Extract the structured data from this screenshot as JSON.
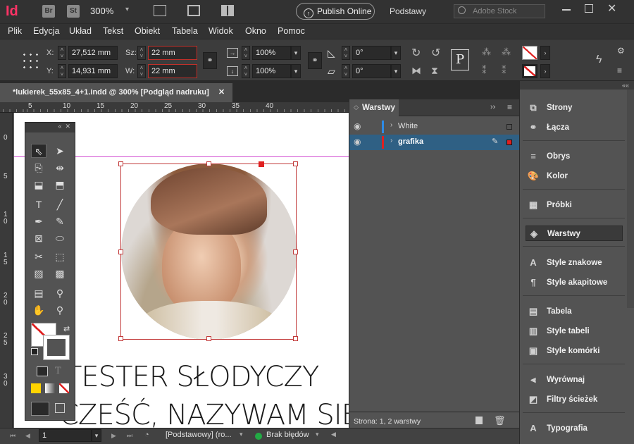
{
  "app": {
    "logo": "Id",
    "br": "Br",
    "st": "St",
    "zoom": "300%",
    "publish_label": "Publish Online",
    "workspace": "Podstawy",
    "search_placeholder": "Adobe Stock"
  },
  "menu": [
    "Plik",
    "Edycja",
    "Układ",
    "Tekst",
    "Obiekt",
    "Tabela",
    "Widok",
    "Okno",
    "Pomoc"
  ],
  "control": {
    "x_label": "X:",
    "x_value": "27,512 mm",
    "y_label": "Y:",
    "y_value": "14,931 mm",
    "w_label": "Sz:",
    "w_value": "22 mm",
    "h_label": "W:",
    "h_value": "22 mm",
    "scale_x": "100%",
    "scale_y": "100%",
    "angle": "0°",
    "shear": "0°"
  },
  "document": {
    "tab_title": "*lukierek_55x85_4+1.indd @ 300% [Podgląd nadruku]",
    "ruler_ticks": [
      "5",
      "10",
      "15",
      "20",
      "25",
      "30",
      "35",
      "40"
    ],
    "vruler_ticks": [
      "0",
      "5",
      "1\n0",
      "1\n5",
      "2\n0",
      "2\n5",
      "3\n0"
    ],
    "line1": "TESTER SŁODYCZY",
    "line2": "CZEŚĆ, NAZYWAM SIE"
  },
  "layers": {
    "title": "Warstwy",
    "rows": [
      {
        "name": "White",
        "color": "#2d8be6"
      },
      {
        "name": "grafika",
        "color": "#e02020"
      }
    ],
    "footer": "Strona: 1, 2 warstwy"
  },
  "dock": [
    {
      "label": "Strony",
      "icon": "pages-icon"
    },
    {
      "label": "Łącza",
      "icon": "links-icon"
    },
    {
      "label": "Obrys",
      "icon": "stroke-icon"
    },
    {
      "label": "Kolor",
      "icon": "color-icon"
    },
    {
      "label": "Próbki",
      "icon": "swatches-icon"
    },
    {
      "label": "Warstwy",
      "icon": "layers-icon"
    },
    {
      "label": "Style znakowe",
      "icon": "char-styles-icon"
    },
    {
      "label": "Style akapitowe",
      "icon": "para-styles-icon"
    },
    {
      "label": "Tabela",
      "icon": "table-icon"
    },
    {
      "label": "Style tabeli",
      "icon": "table-styles-icon"
    },
    {
      "label": "Style komórki",
      "icon": "cell-styles-icon"
    },
    {
      "label": "Wyrównaj",
      "icon": "align-icon"
    },
    {
      "label": "Filtry ścieżek",
      "icon": "pathfinder-icon"
    },
    {
      "label": "Typografia",
      "icon": "glyphs-icon"
    }
  ],
  "status": {
    "page": "1",
    "style": "[Podstawowy] (ro...",
    "preflight": "Brak błędów"
  },
  "colors": {
    "accent": "#ff3366",
    "selection": "#c23a3a",
    "ok": "#22aa44"
  }
}
